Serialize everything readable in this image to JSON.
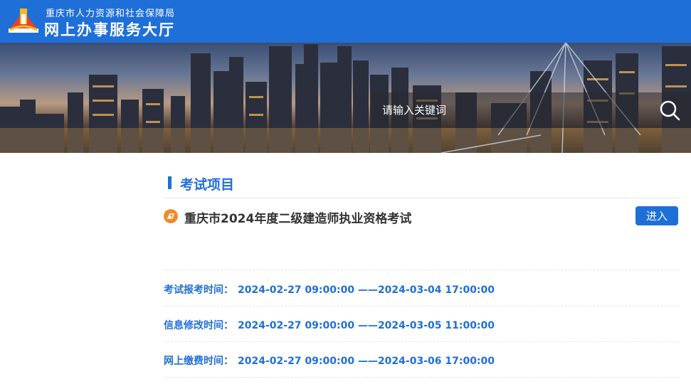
{
  "header": {
    "org_name": "重庆市人力资源和社会保障局",
    "hall_name": "网上办事服务大厅",
    "brand_color": "#1f6fd9"
  },
  "banner": {
    "search_placeholder": "请输入关键词",
    "search_icon": "search-icon"
  },
  "section": {
    "title": "考试项目"
  },
  "exam": {
    "name": "重庆市2024年度二级建造师执业资格考试",
    "enter_label": "进入",
    "icon": "exam-icon",
    "icon_color": "#f08a2a"
  },
  "schedule": [
    {
      "label": "考试报考时间：",
      "value": "2024-02-27 09:00:00 ——2024-03-04 17:00:00"
    },
    {
      "label": "信息修改时间：",
      "value": "2024-02-27 09:00:00 ——2024-03-05 11:00:00"
    },
    {
      "label": "网上缴费时间：",
      "value": "2024-02-27 09:00:00 ——2024-03-06 17:00:00"
    }
  ]
}
